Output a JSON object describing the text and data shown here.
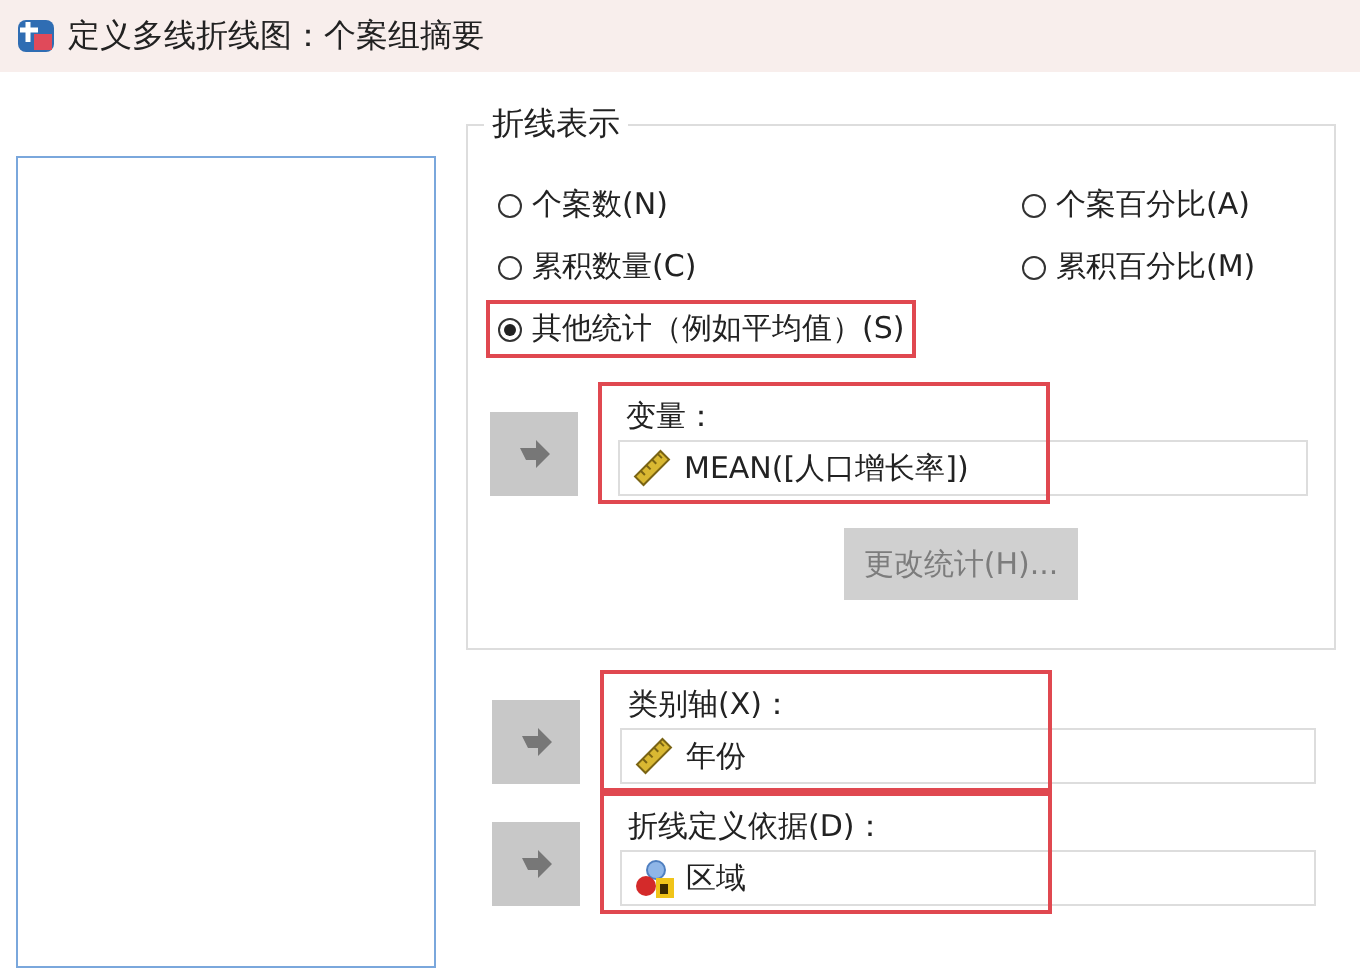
{
  "window": {
    "title": "定义多线折线图：个案组摘要"
  },
  "line_represents": {
    "title": "折线表示",
    "options": [
      {
        "label": "个案数(N)",
        "selected": false,
        "highlighted": false
      },
      {
        "label": "个案百分比(A)",
        "selected": false,
        "highlighted": false
      },
      {
        "label": "累积数量(C)",
        "selected": false,
        "highlighted": false
      },
      {
        "label": "累积百分比(M)",
        "selected": false,
        "highlighted": false
      },
      {
        "label": "其他统计（例如平均值）(S)",
        "selected": true,
        "highlighted": true
      }
    ],
    "variable": {
      "label": "变量：",
      "value": "MEAN([人口增长率])",
      "kind": "scale",
      "highlighted": true
    },
    "change_button": {
      "label": "更改统计(H)...",
      "disabled": true
    }
  },
  "category_axis": {
    "label": "类别轴(X)：",
    "value": "年份",
    "kind": "scale",
    "highlighted": true
  },
  "define_lines_by": {
    "label": "折线定义依据(D)：",
    "value": "区域",
    "kind": "nominal",
    "highlighted": true
  }
}
